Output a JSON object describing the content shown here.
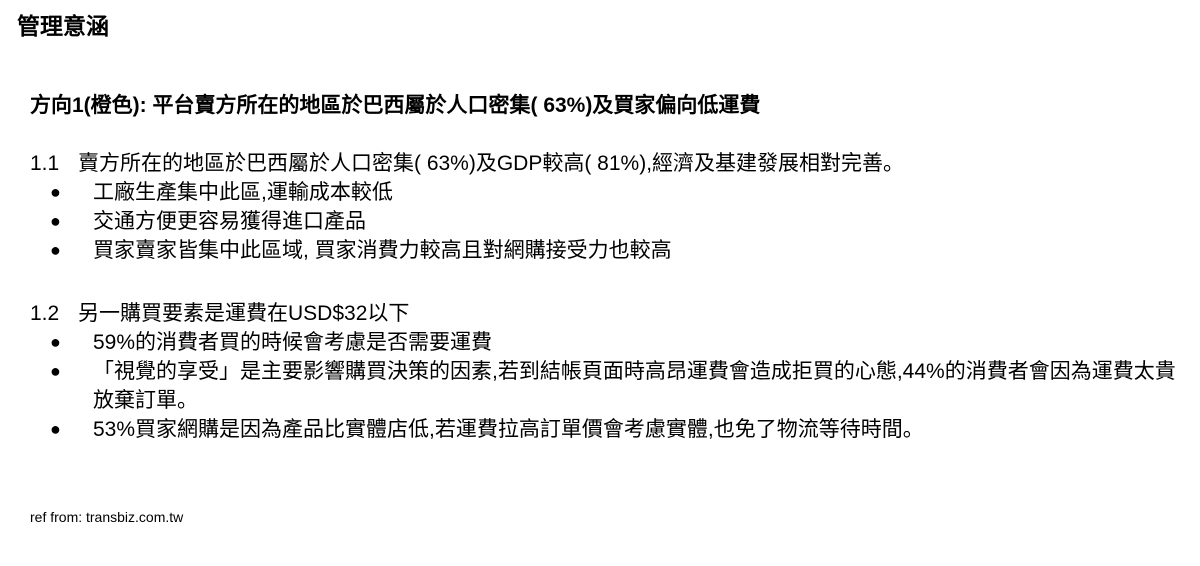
{
  "title": "管理意涵",
  "direction_heading": "方向1(橙色): 平台賣方所在的地區於巴西屬於人口密集( 63%)及買家偏向低運費",
  "sections": [
    {
      "number": "1.1",
      "text": "賣方所在的地區於巴西屬於人口密集( 63%)及GDP較高( 81%),經濟及基建發展相對完善。",
      "bullets": [
        "工廠生產集中此區,運輸成本較低",
        "交通方便更容易獲得進口產品",
        "買家賣家皆集中此區域, 買家消費力較高且對網購接受力也較高"
      ]
    },
    {
      "number": "1.2",
      "text": "另一購買要素是運費在USD$32以下",
      "bullets": [
        "59%的消費者買的時候會考慮是否需要運費",
        "「視覺的享受」是主要影響購買決策的因素,若到結帳頁面時高昂運費會造成拒買的心態,44%的消費者會因為運費太貴放棄訂單。",
        "53%買家網購是因為產品比實體店低,若運費拉高訂單價會考慮實體,也免了物流等待時間。"
      ]
    }
  ],
  "bullet_char": "●",
  "reference": "ref from: transbiz.com.tw"
}
